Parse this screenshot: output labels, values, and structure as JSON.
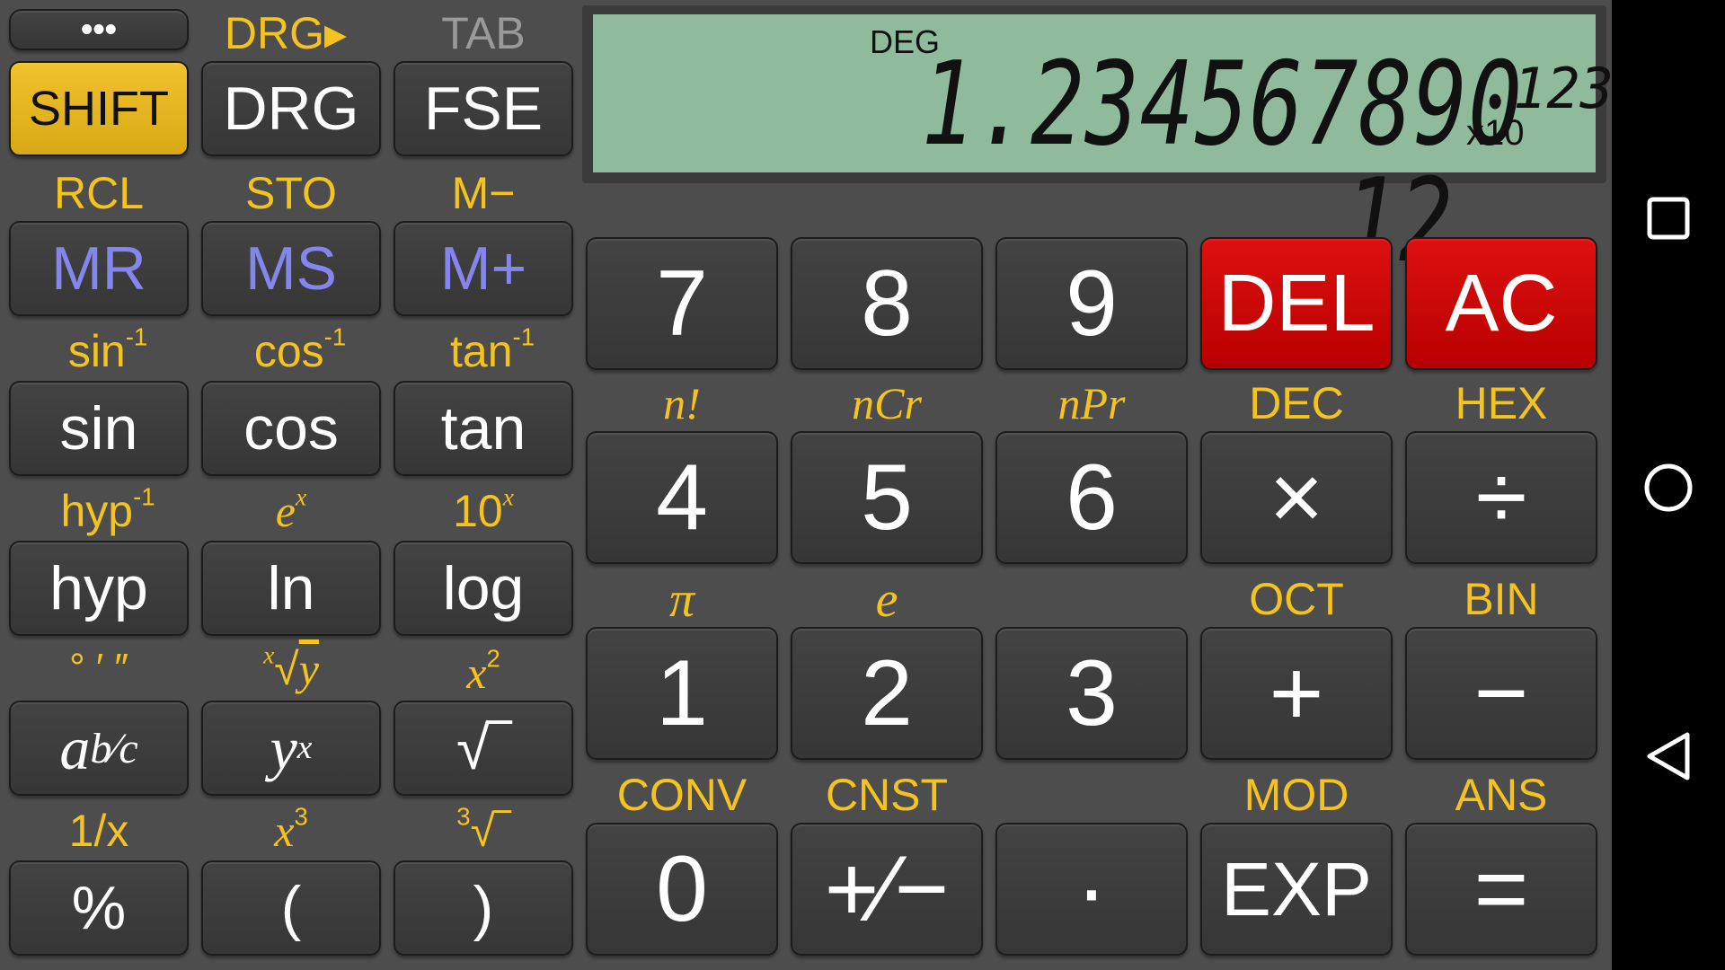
{
  "display": {
    "mode": "DEG",
    "value": "1.234567890 12",
    "exponent_base": "x10",
    "exponent_digits": "123"
  },
  "top_row": {
    "menu_label": "•••",
    "drg_shift_label": "DRG▸",
    "tab_label": "TAB"
  },
  "left_keys": {
    "shift": "SHIFT",
    "drg": "DRG",
    "fse": "FSE",
    "rcl": "RCL",
    "sto": "STO",
    "m_minus": "M−",
    "mr": "MR",
    "ms": "MS",
    "m_plus": "M+",
    "sin_inv": "sin",
    "cos_inv": "cos",
    "tan_inv": "tan",
    "inv_sup": "-1",
    "sin": "sin",
    "cos": "cos",
    "tan": "tan",
    "hyp_inv": "hyp",
    "ex_base": "e",
    "ex_sup": "x",
    "tenx_base": "10",
    "tenx_sup": "x",
    "hyp": "hyp",
    "ln": "ln",
    "log": "log",
    "dms": "° ′ ″",
    "xroot_x": "x",
    "xroot_rad": "√",
    "xroot_y": "y",
    "x2_base": "x",
    "x2_sup": "2",
    "abc_a": "a",
    "abc_bc": "b⁄c",
    "yx_base": "y",
    "yx_sup": "x",
    "sqrt": "√‾",
    "recip": "1/x",
    "x3_base": "x",
    "x3_sup": "3",
    "cbrt_idx": "3",
    "cbrt_rad": "√‾",
    "percent": "%",
    "lparen": "(",
    "rparen": ")"
  },
  "right_keys": {
    "k7": "7",
    "k8": "8",
    "k9": "9",
    "del": "DEL",
    "ac": "AC",
    "nfact": "n!",
    "ncr": "nCr",
    "npr": "nPr",
    "dec": "DEC",
    "hex": "HEX",
    "k4": "4",
    "k5": "5",
    "k6": "6",
    "mul": "×",
    "div": "÷",
    "pi": "π",
    "e": "e",
    "oct": "OCT",
    "bin": "BIN",
    "k1": "1",
    "k2": "2",
    "k3": "3",
    "plus": "+",
    "minus": "−",
    "conv": "CONV",
    "cnst": "CNST",
    "mod": "MOD",
    "ans": "ANS",
    "k0": "0",
    "plusminus": "+⁄−",
    "dot": "·",
    "exp": "EXP",
    "equals": "="
  },
  "navbar": {
    "icons": [
      "recents-square-icon",
      "home-circle-icon",
      "back-triangle-icon"
    ]
  },
  "colors": {
    "background": "#4d4d4d",
    "key": "#3c3c3c",
    "shift_label": "#f5c320",
    "shift_key": "#e8b820",
    "memory_text": "#8585ee",
    "red_key": "#cc0000",
    "display_bg": "#8fba9b"
  }
}
